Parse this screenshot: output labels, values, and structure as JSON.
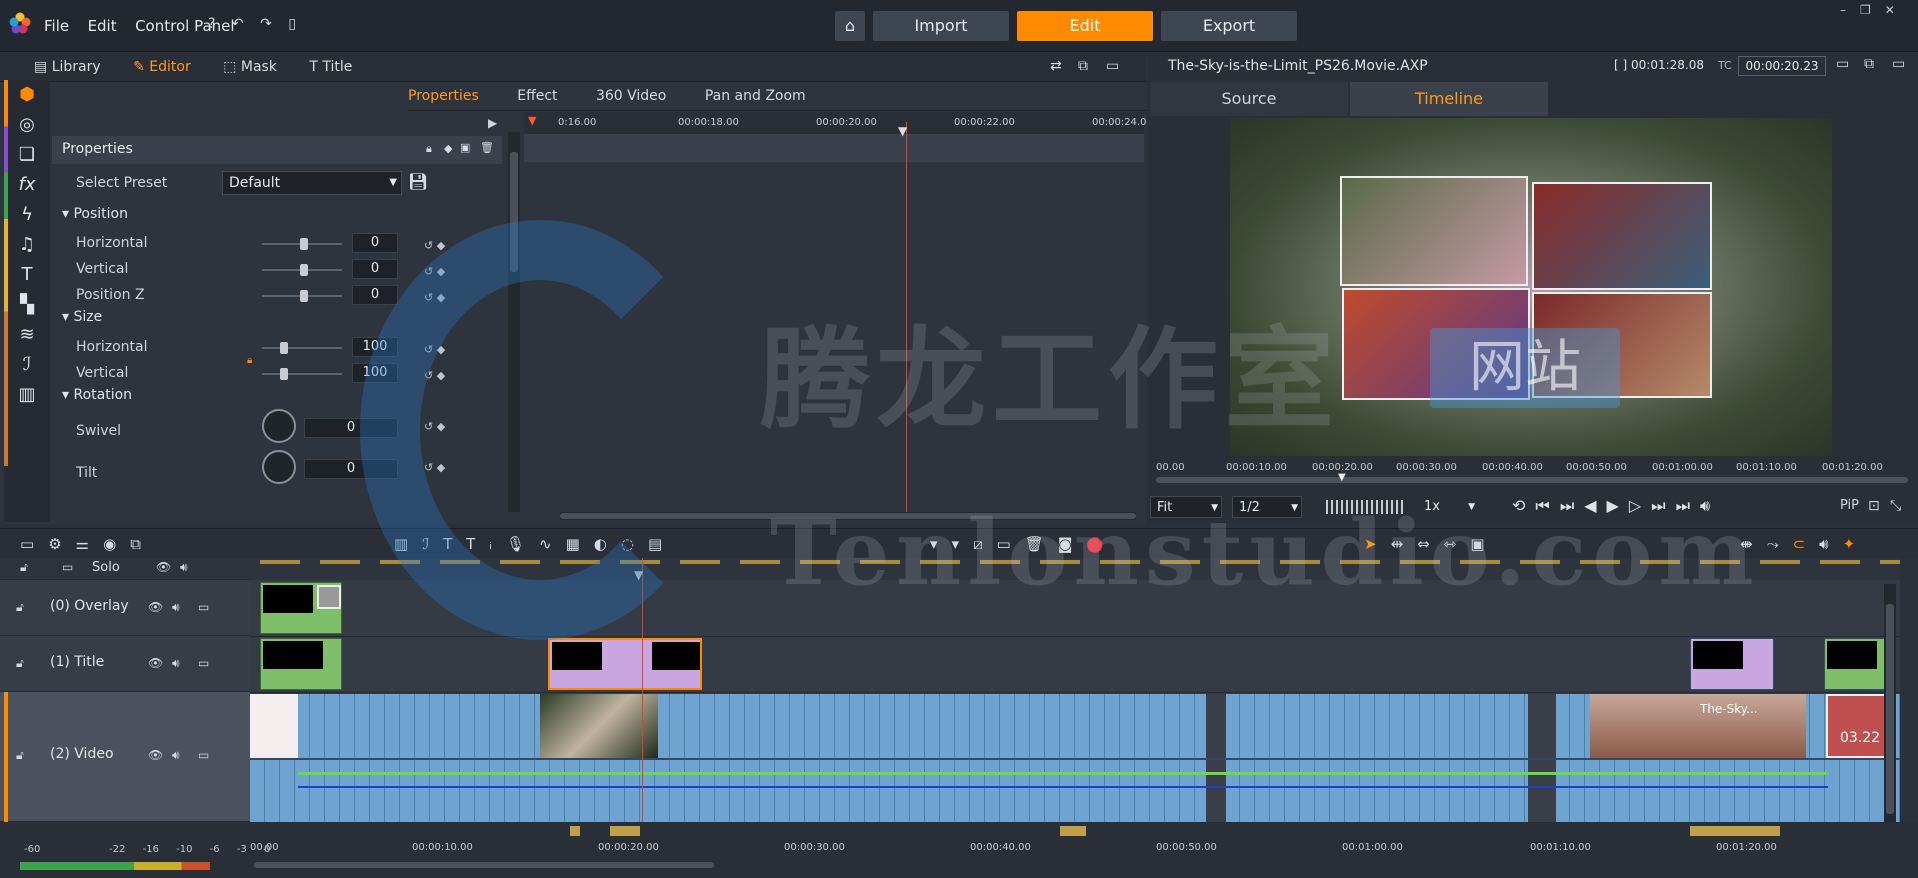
{
  "app": {
    "menu": [
      "File",
      "Edit",
      "Control Panel"
    ],
    "modes": [
      "Import",
      "Edit",
      "Export"
    ],
    "active_mode": "Edit"
  },
  "left_panel": {
    "tabs": [
      "Library",
      "Editor",
      "Mask",
      "Title"
    ],
    "active_tab": "Editor",
    "subtabs": [
      "Properties",
      "Effect",
      "360 Video",
      "Pan and Zoom"
    ],
    "active_subtab": "Properties",
    "properties_title": "Properties",
    "select_preset_label": "Select Preset",
    "select_preset_value": "Default",
    "sections": {
      "position": "Position",
      "size": "Size",
      "rotation": "Rotation"
    },
    "rows": {
      "pos_h": {
        "label": "Horizontal",
        "value": "0"
      },
      "pos_v": {
        "label": "Vertical",
        "value": "0"
      },
      "pos_z": {
        "label": "Position Z",
        "value": "0"
      },
      "size_h": {
        "label": "Horizontal",
        "value": "100"
      },
      "size_v": {
        "label": "Vertical",
        "value": "100"
      },
      "swivel": {
        "label": "Swivel",
        "value": "0"
      },
      "tilt": {
        "label": "Tilt",
        "value": "0"
      }
    },
    "ruler": [
      "0:16.00",
      "00:00:18.00",
      "00:00:20.00",
      "00:00:22.00",
      "00:00:24.0"
    ]
  },
  "preview": {
    "filename": "The-Sky-is-the-Limit_PS26.Movie.AXP",
    "duration_label": "[ ]",
    "duration": "00:01:28.08",
    "tc_label": "TC",
    "timecode": "00:00:20.23",
    "tabs": [
      "Source",
      "Timeline"
    ],
    "active_tab": "Timeline",
    "ruler": [
      "00.00",
      "00:00:10.00",
      "00:00:20.00",
      "00:00:30.00",
      "00:00:40.00",
      "00:00:50.00",
      "00:01:00.00",
      "00:01:10.00",
      "00:01:20.00"
    ],
    "fit": "Fit",
    "quality": "1/2",
    "speed": "1x",
    "pip": "PiP"
  },
  "timeline": {
    "solo": "Solo",
    "tracks": [
      {
        "name": "(0) Overlay"
      },
      {
        "name": "(1) Title"
      },
      {
        "name": "(2) Video"
      }
    ],
    "clip_label": "The-Sky...",
    "clip_time": "03.22",
    "ruler": [
      "00.00",
      "00:00:10.00",
      "00:00:20.00",
      "00:00:30.00",
      "00:00:40.00",
      "00:00:50.00",
      "00:01:00.00",
      "00:01:10.00",
      "00:01:20.00"
    ],
    "meter_scale": [
      "-60",
      "-22",
      "-16",
      "-10",
      "-6",
      "-3",
      "0"
    ]
  },
  "watermark": {
    "line1": "腾龙工作室",
    "line1b": "网站",
    "line2": "Tenlonstudio.com"
  },
  "colors": {
    "accent": "#ff8a00",
    "clip_blue": "#6fa3d0",
    "title_purple": "#c9a6e0",
    "overlay_green": "#7fbf6a"
  }
}
